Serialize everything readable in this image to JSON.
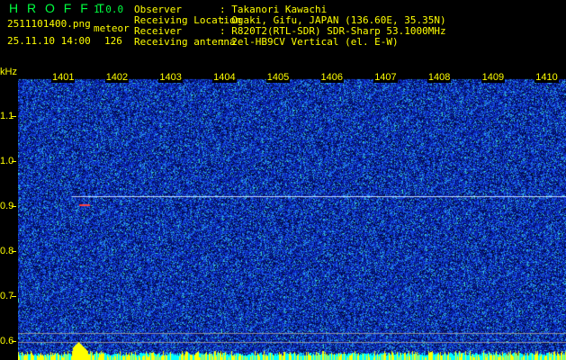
{
  "app": {
    "name": "H R O F F T",
    "version": "1.0.0"
  },
  "file": {
    "name": "2511101400.png",
    "datetime": "25.11.10 14:00"
  },
  "meteor": {
    "label": "meteor",
    "count": "126"
  },
  "info": [
    {
      "label": "Observer",
      "value": ": Takanori Kawachi"
    },
    {
      "label": "Receiving Location",
      "value": ": Ogaki, Gifu, JAPAN (136.60E, 35.35N)"
    },
    {
      "label": "Receiver",
      "value": ": R820T2(RTL-SDR) SDR-Sharp 53.1000MHz"
    },
    {
      "label": "Receiving antenna",
      "value": ": 2el-HB9CV Vertical (el. E-W)"
    }
  ],
  "y_axis": {
    "unit": "kHz",
    "ticks": [
      "1.1",
      "1.0",
      "0.9",
      "0.8",
      "0.7",
      "0.6"
    ]
  },
  "x_axis": {
    "ticks": [
      "1401",
      "1402",
      "1403",
      "1404",
      "1405",
      "1406",
      "1407",
      "1408",
      "1409",
      "1410"
    ]
  },
  "colors": {
    "accent_green": "#00ff40",
    "text_yellow": "#ffff00",
    "noise_blue": "#1030c0",
    "level_cyan": "#00ffff"
  }
}
